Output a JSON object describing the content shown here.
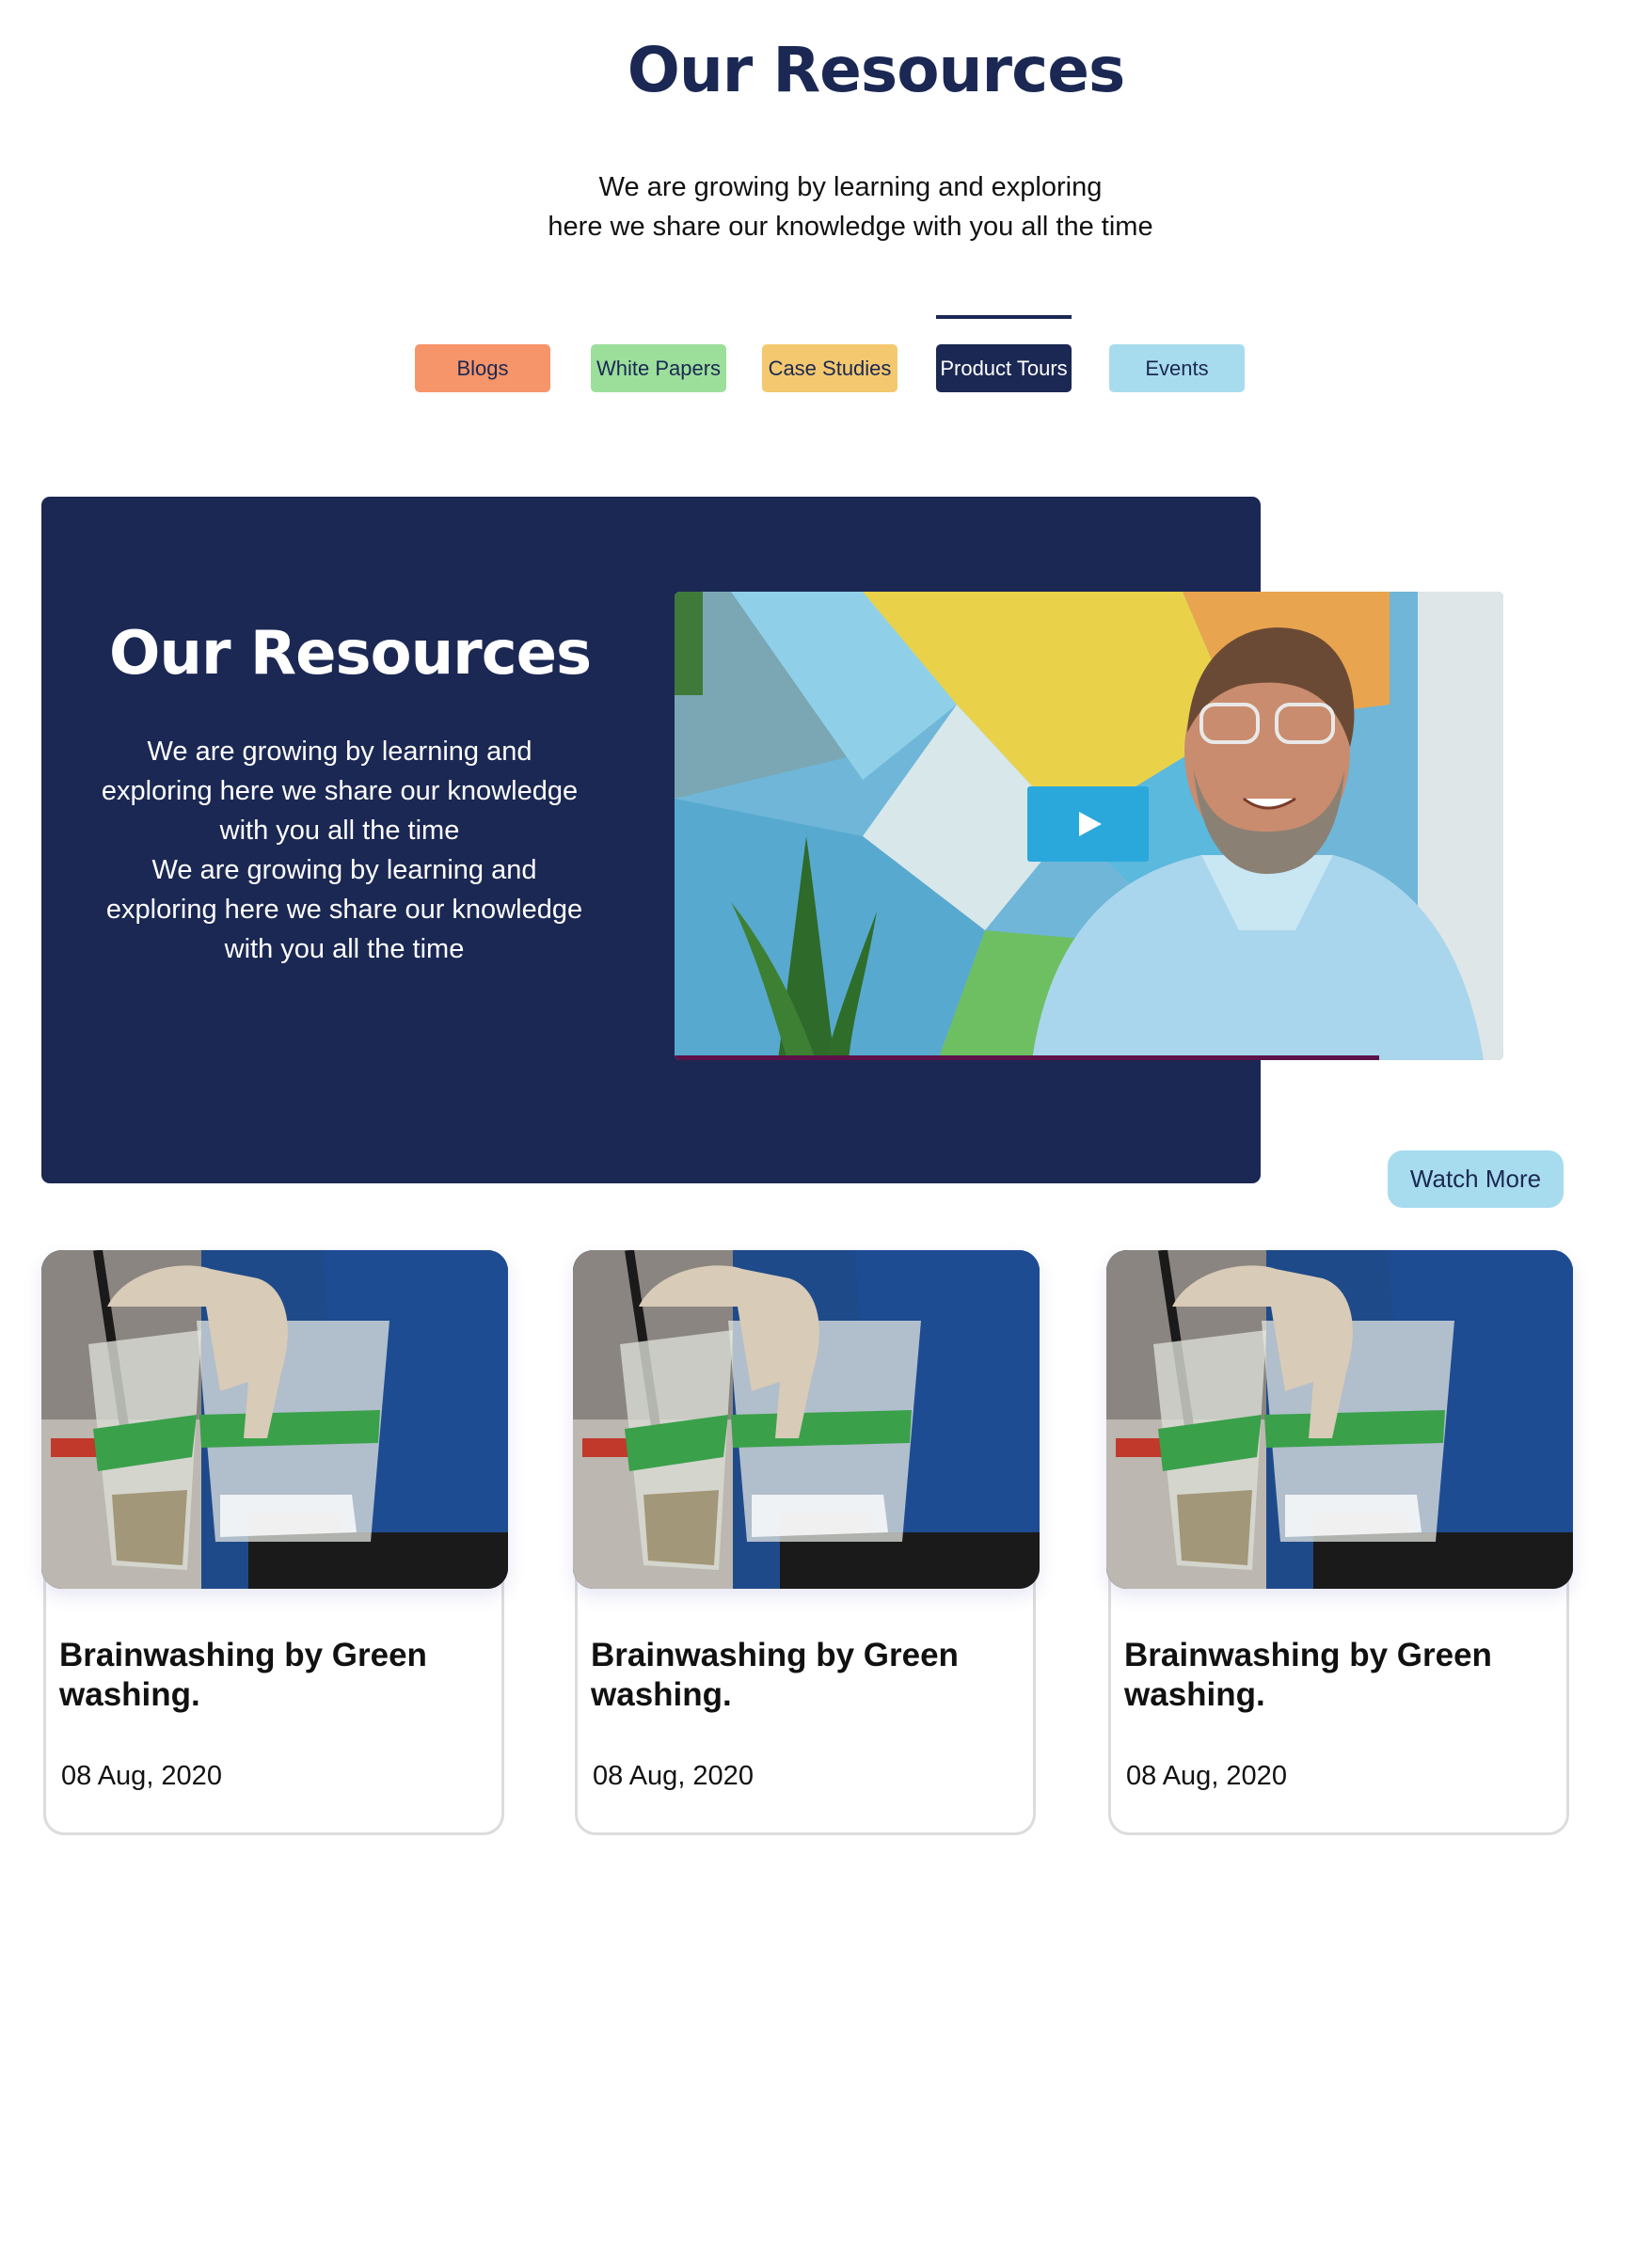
{
  "header": {
    "title": "Our Resources",
    "subtitle_line1": "We are growing by learning and exploring",
    "subtitle_line2": "here we share our knowledge with you all the time"
  },
  "tabs": [
    {
      "label": "Blogs",
      "color": "#f6956a",
      "active": false
    },
    {
      "label": "White Papers",
      "color": "#9bdf9b",
      "active": false
    },
    {
      "label": "Case Studies",
      "color": "#f4c86e",
      "active": false
    },
    {
      "label": "Product Tours",
      "color": "#1b2853",
      "active": true
    },
    {
      "label": "Events",
      "color": "#a7dcee",
      "active": false
    }
  ],
  "hero": {
    "title": "Our Resources",
    "paragraph1": "We are growing by learning and exploring here we share our knowledge with you all the time",
    "paragraph2": "We are growing by learning and exploring here we share our knowledge with you all the time",
    "video_progress": 0.85
  },
  "watch_more_label": "Watch More",
  "cards": [
    {
      "title": "Brainwashing by Green washing.",
      "date": "08 Aug, 2020"
    },
    {
      "title": "Brainwashing by Green washing.",
      "date": "08 Aug, 2020"
    },
    {
      "title": "Brainwashing by Green washing.",
      "date": "08 Aug, 2020"
    }
  ],
  "colors": {
    "navy": "#1b2853",
    "play_button": "#2aa8dc",
    "watch_more_bg": "#a7dcee"
  }
}
